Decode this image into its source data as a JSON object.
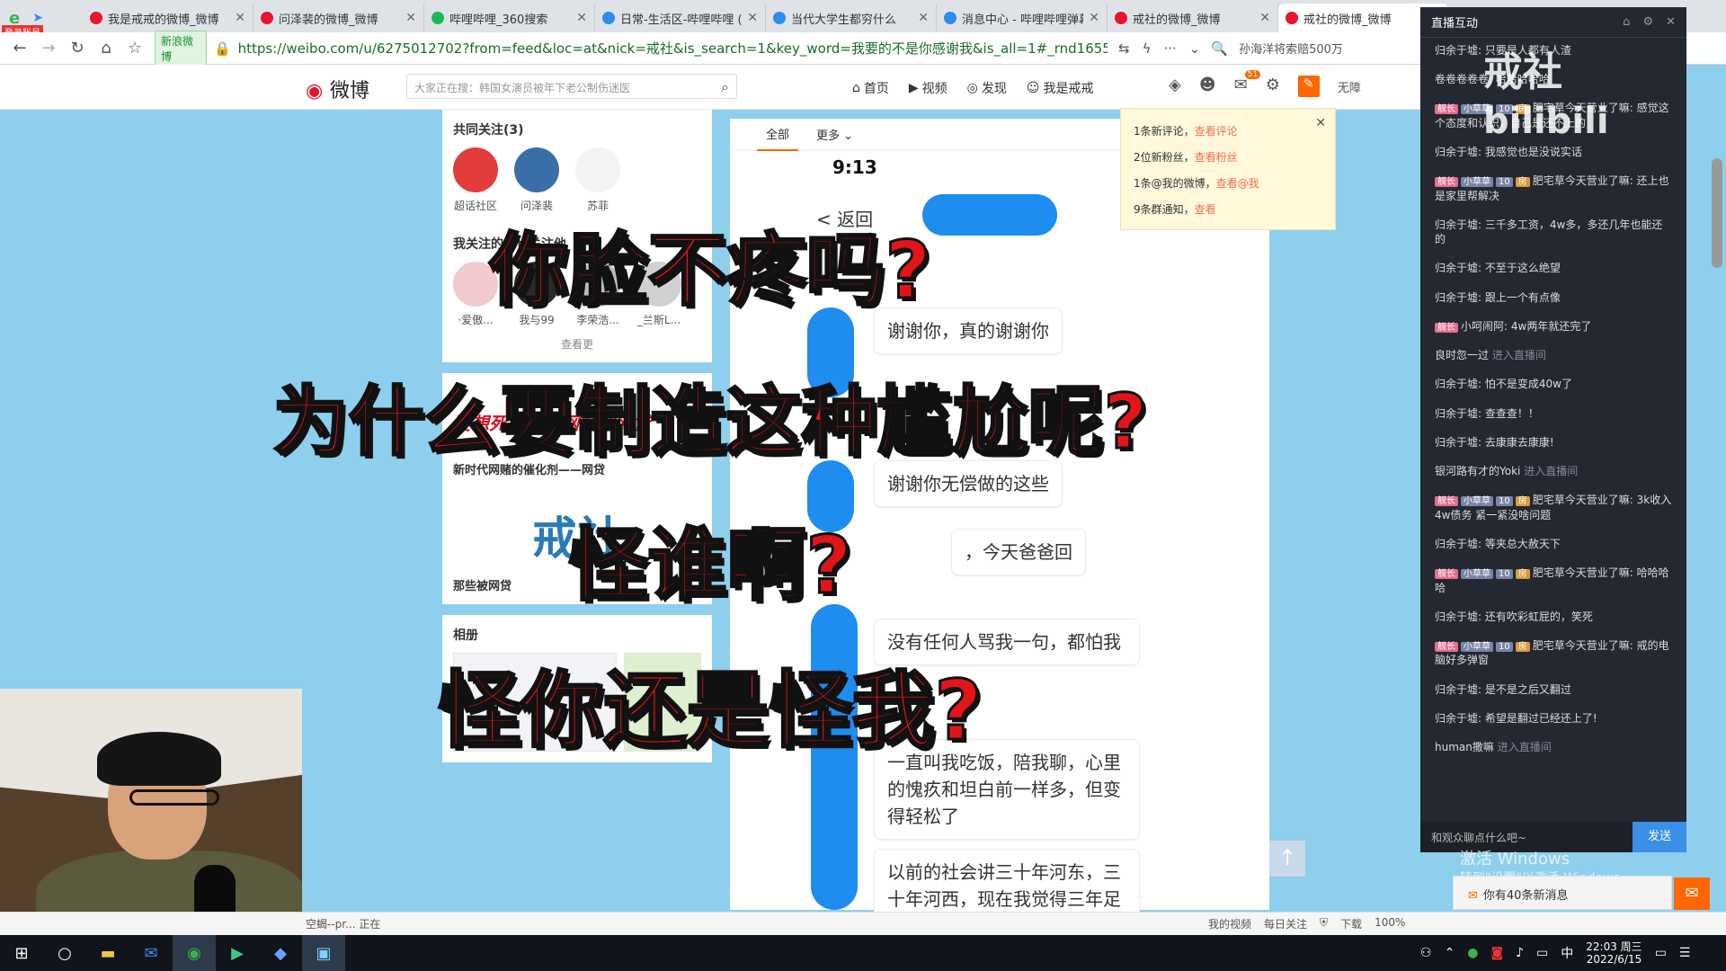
{
  "browser": {
    "tabs": [
      {
        "label": "我是戒戒的微博_微博",
        "color": "#e6162d"
      },
      {
        "label": "问泽裴的微博_微博",
        "color": "#e6162d"
      },
      {
        "label": "哔哩哔哩_360搜索",
        "color": "#19b955"
      },
      {
        "label": "日常-生活区-哔哩哔哩 (",
        "color": "#2e8de8"
      },
      {
        "label": "当代大学生都穷什么",
        "color": "#2e8de8"
      },
      {
        "label": "消息中心 - 哔哩哔哩弹幕",
        "color": "#2e8de8"
      },
      {
        "label": "戒社的微博_微博",
        "color": "#e6162d"
      },
      {
        "label": "戒社的微博_微博",
        "color": "#e6162d"
      }
    ],
    "corner_badge": "登录账号",
    "secure_label": "新浪微博",
    "url": "https://weibo.com/u/6275012702?from=feed&loc=at&nick=戒社&is_search=1&key_word=我要的不是你感谢我&is_all=1#_rnd1655301798726",
    "search_hint": "孙海洋将索赔500万"
  },
  "weibo": {
    "logo_text": "微博",
    "search_placeholder": "大家正在搜：韩国女演员被年下老公制伤迷医",
    "nav": [
      "首页",
      "视频",
      "发现",
      "我是戒戒"
    ],
    "mail_badge": "51",
    "right_label": "无障"
  },
  "left": {
    "follow_title": "共同关注(3)",
    "follows": [
      {
        "name": "超话社区",
        "color": "#e23c3c"
      },
      {
        "name": "问泽裴",
        "color": "#3a6ea8"
      },
      {
        "name": "苏菲",
        "color": "#f3f3f3"
      }
    ],
    "also_title": "我关注的人也关注他",
    "also": [
      {
        "name": "·爱傲...",
        "color": "#f2c9cf"
      },
      {
        "name": "我与99",
        "color": "#2a2a2a"
      },
      {
        "name": "李荣浩...",
        "color": "#bcbcbc"
      },
      {
        "name": "_兰斯L...",
        "color": "#d0d0d0"
      }
    ],
    "see_more": "查看更",
    "ad_text": "要想死的快，网赌加网贷",
    "ad_title": "新时代网赌的催化剂——网贷",
    "ad_logo": "戒社",
    "ad2_title": "那些被网贷",
    "album_title": "相册"
  },
  "center": {
    "tabs": [
      "全部",
      "更多"
    ],
    "phone_time": "9:13",
    "back": "< 返回",
    "bubbles": [
      "谢谢你，真的谢谢你",
      "谢谢你无偿做的这些",
      "，今天爸爸回",
      "没有任何人骂我一句，都怕我",
      "一直叫我吃饭，陪我聊，心里的愧疚和坦白前一样多，但变得轻松了",
      "以前的社会讲三十年河东，三十年河西，现在我觉得三年足"
    ]
  },
  "notifications": [
    {
      "text": "1条新评论，",
      "link": "查看评论"
    },
    {
      "text": "2位新粉丝，",
      "link": "查看粉丝"
    },
    {
      "text": "1条@我的微博，",
      "link": "查看@我"
    },
    {
      "text": "9条群通知，",
      "link": "查看"
    }
  ],
  "overlay": [
    "你脸不疼吗?",
    "为什么要制造这种尴尬呢?",
    "怪谁啊?",
    "怪你还是怪我?"
  ],
  "chat": {
    "title": "直播互动",
    "watermark": "戒社",
    "messages": [
      {
        "user": "归余于墟:",
        "text": "只要是人都有人渣"
      },
      {
        "user": "",
        "text": "卷卷卷卷卷: 哈哈哈哈哈"
      },
      {
        "user": "肥宅草今天营业了嘛:",
        "text": "感觉这个态度和认识，自己是还不上的",
        "fan": true
      },
      {
        "user": "归余于墟:",
        "text": "我感觉也是没说实话"
      },
      {
        "user": "肥宅草今天营业了嘛:",
        "text": "还上也是家里帮解决",
        "fan": true
      },
      {
        "user": "归余于墟:",
        "text": "三千多工资，4w多，多还几年也能还的"
      },
      {
        "user": "归余于墟:",
        "text": "不至于这么绝望"
      },
      {
        "user": "归余于墟:",
        "text": "跟上一个有点像"
      },
      {
        "user": "小呵闹阿:",
        "text": "4w两年就还完了",
        "guard": true
      },
      {
        "user": "良时忽一过",
        "text": "进入直播间",
        "enter": true
      },
      {
        "user": "归余于墟:",
        "text": "怕不是变成40w了"
      },
      {
        "user": "归余于墟:",
        "text": "查查查！！"
      },
      {
        "user": "归余于墟:",
        "text": "去康康去康康!"
      },
      {
        "user": "银河路有才的Yoki",
        "text": "进入直播间",
        "enter": true
      },
      {
        "user": "肥宅草今天营业了嘛:",
        "text": "3k收入4w债务 紧一紧没啥问题",
        "fan": true
      },
      {
        "user": "归余于墟:",
        "text": "等夹总大赦天下"
      },
      {
        "user": "肥宅草今天营业了嘛:",
        "text": "哈哈哈哈",
        "fan": true
      },
      {
        "user": "归余于墟:",
        "text": "还有吹彩虹屁的，笑死"
      },
      {
        "user": "肥宅草今天营业了嘛:",
        "text": "戒的电脑好多弹窗",
        "fan": true
      },
      {
        "user": "归余于墟:",
        "text": "是不是之后又翻过"
      },
      {
        "user": "归余于墟:",
        "text": "希望是翻过已经还上了!"
      },
      {
        "user": "human撒嘛",
        "text": "进入直播间",
        "enter": true
      }
    ],
    "badge_guard": "舰长",
    "badge_medal": "小草草",
    "badge_level": "10",
    "badge_room": "房",
    "input_placeholder": "和观众聊点什么吧~",
    "send_label": "发送"
  },
  "windows": {
    "activate_title": "激活 Windows",
    "activate_sub": "转到\"设置\"以激活 Windows。",
    "newmsg": "你有40条新消息"
  },
  "statusbar": {
    "left": "空蝎--pr... 正在",
    "items": [
      "我的视频",
      "每日关注",
      "下载",
      "100%"
    ]
  },
  "taskbar": {
    "ime": "中",
    "time": "22:03 周三",
    "date": "2022/6/15"
  }
}
